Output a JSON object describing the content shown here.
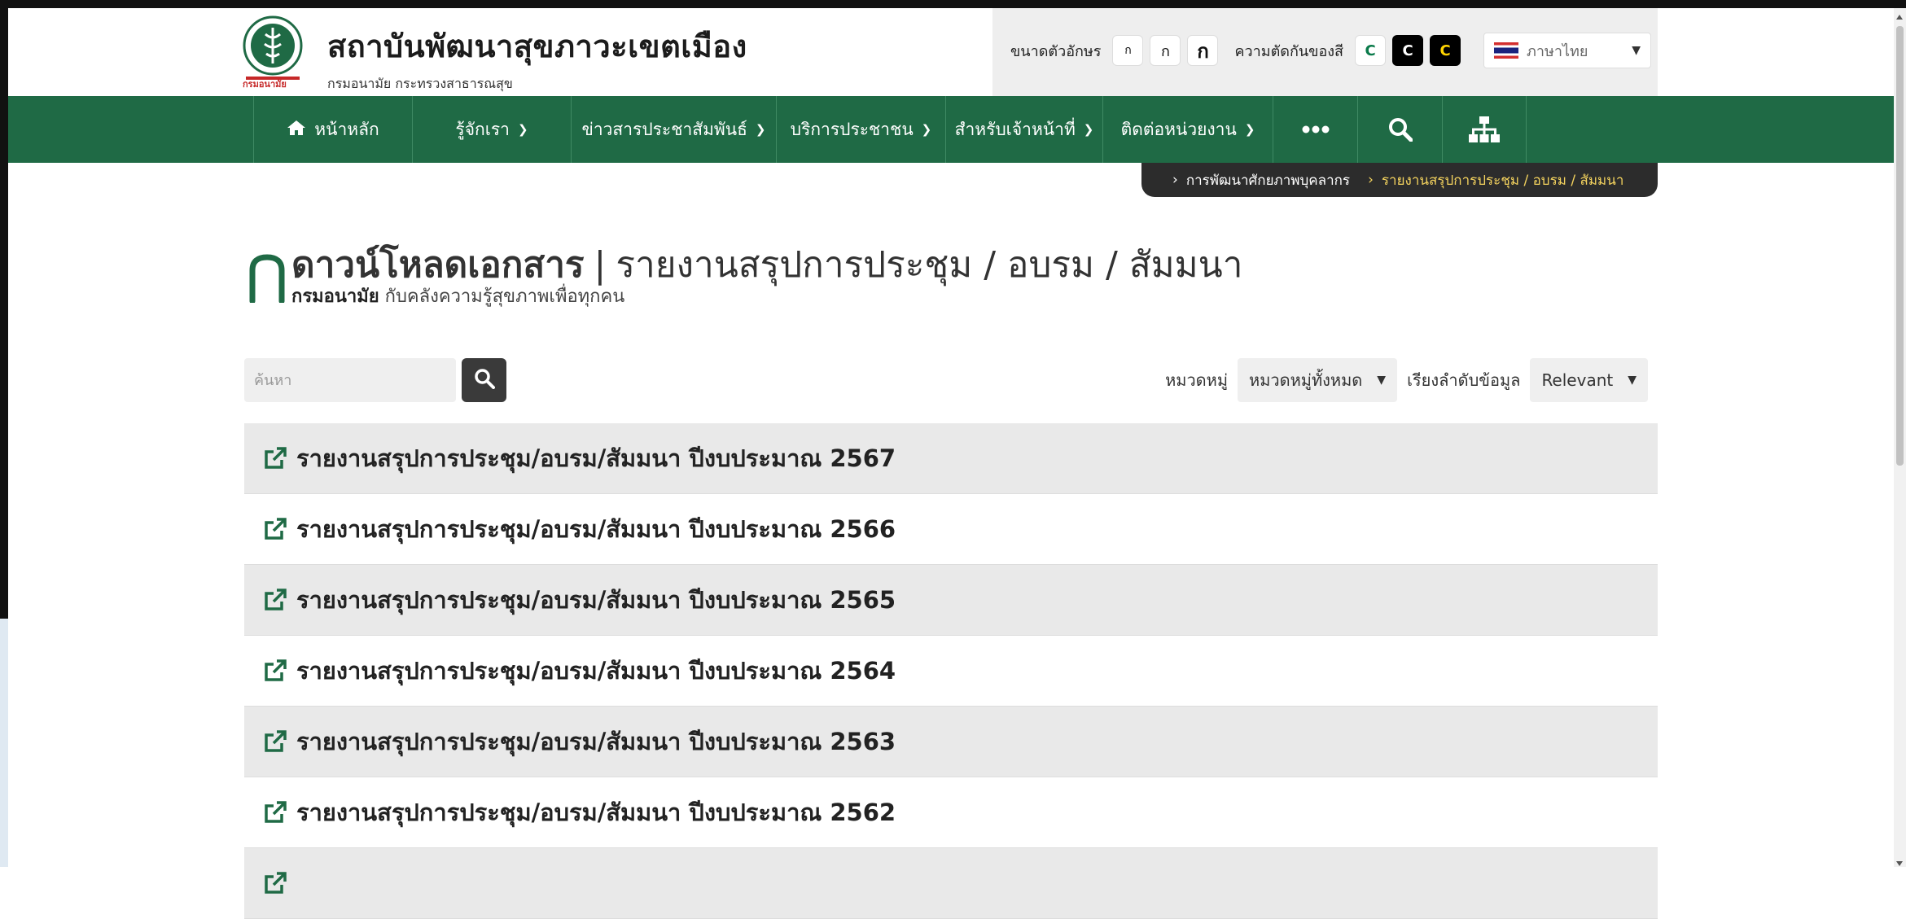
{
  "header": {
    "title": "สถาบันพัฒนาสุขภาวะเขตเมือง",
    "subtitle": "กรมอนามัย กระทรวงสาธารณสุข",
    "logo_caption": "กรมอนามัย"
  },
  "accessibility": {
    "font_size_label": "ขนาดตัวอักษร",
    "font_buttons": [
      "ก",
      "ก",
      "ก"
    ],
    "contrast_label": "ความตัดกันของสี",
    "contrast_buttons": [
      "C",
      "C",
      "C"
    ],
    "language": "ภาษาไทย"
  },
  "nav": {
    "items": [
      {
        "label": "หน้าหลัก"
      },
      {
        "label": "รู้จักเรา"
      },
      {
        "label": "ข่าวสารประชาสัมพันธ์"
      },
      {
        "label": "บริการประชาชน"
      },
      {
        "label": "สำหรับเจ้าหน้าที่"
      },
      {
        "label": "ติดต่อหน่วยงาน"
      }
    ],
    "more_icon": "ellipsis-icon",
    "search_icon": "search-icon",
    "sitemap_icon": "sitemap-icon"
  },
  "breadcrumb": {
    "items": [
      "การพัฒนาศักยภาพบุคลากร",
      "รายงานสรุปการประชุม / อบรม / สัมมนา"
    ]
  },
  "page": {
    "title_main": "ดาวน์โหลดเอกสาร",
    "title_sub": "รายงานสรุปการประชุม / อบรม / สัมมนา",
    "tag_bold": "กรมอนามัย",
    "tag_rest": " กับคลังความรู้สุขภาพเพื่อทุกคน"
  },
  "filters": {
    "search_placeholder": "ค้นหา",
    "category_label": "หมวดหมู่",
    "category_value": "หมวดหมู่ทั้งหมด",
    "sort_label": "เรียงลำดับข้อมูล",
    "sort_value": "Relevant"
  },
  "documents": [
    {
      "title": "รายงานสรุปการประชุม/อบรม/สัมมนา ปีงบประมาณ 2567"
    },
    {
      "title": "รายงานสรุปการประชุม/อบรม/สัมมนา ปีงบประมาณ 2566"
    },
    {
      "title": "รายงานสรุปการประชุม/อบรม/สัมมนา ปีงบประมาณ 2565"
    },
    {
      "title": "รายงานสรุปการประชุม/อบรม/สัมมนา ปีงบประมาณ 2564"
    },
    {
      "title": "รายงานสรุปการประชุม/อบรม/สัมมนา ปีงบประมาณ 2563"
    },
    {
      "title": "รายงานสรุปการประชุม/อบรม/สัมมนา ปีงบประมาณ 2562"
    },
    {
      "title": ""
    }
  ],
  "colors": {
    "primary_green": "#1f6a45",
    "breadcrumb_bg": "#2c2c2c",
    "breadcrumb_active": "#f4d35e",
    "row_shade": "#e9e9e9"
  }
}
